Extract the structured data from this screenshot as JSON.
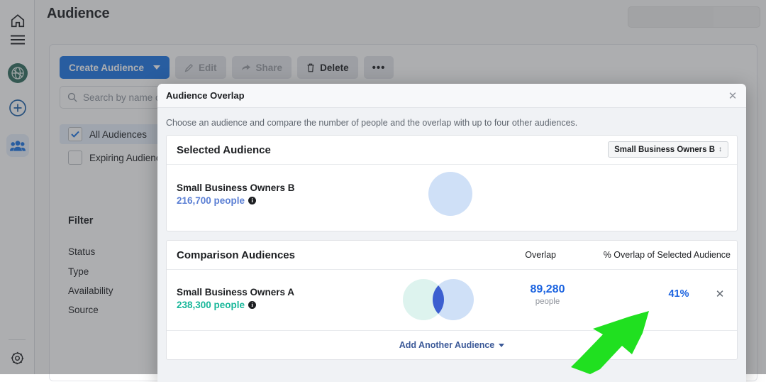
{
  "app": {
    "page_title": "Audience",
    "rail": [
      {
        "name": "home-icon",
        "label": "Home"
      },
      {
        "name": "menu-icon",
        "label": "Menu"
      },
      {
        "name": "globe-icon",
        "label": "Business"
      },
      {
        "name": "plus-circle-icon",
        "label": "Create"
      },
      {
        "name": "people-icon",
        "label": "Audiences"
      },
      {
        "name": "gear-icon",
        "label": "Settings"
      }
    ],
    "toolbar": {
      "create_label": "Create Audience",
      "edit_label": "Edit",
      "share_label": "Share",
      "delete_label": "Delete",
      "more_label": "•••"
    },
    "search": {
      "placeholder": "Search by name or audience ID"
    },
    "checks": [
      {
        "label": "All Audiences",
        "checked": true
      },
      {
        "label": "Expiring Audiences",
        "checked": false
      }
    ],
    "filter": {
      "heading": "Filter",
      "items": [
        "Status",
        "Type",
        "Availability",
        "Source"
      ]
    }
  },
  "modal": {
    "title": "Audience Overlap",
    "close_label": "✕",
    "subtitle": "Choose an audience and compare the number of people and the overlap with up to four other audiences.",
    "selected": {
      "heading": "Selected Audience",
      "selector_value": "Small Business Owners B",
      "audience_name": "Small Business Owners B",
      "audience_people": "216,700 people",
      "info_glyph": "i",
      "circle_color": "#cfe0f7"
    },
    "comparison": {
      "heading": "Comparison Audiences",
      "col_overlap": "Overlap",
      "col_pct": "% Overlap of Selected Audience",
      "rows": [
        {
          "audience_name": "Small Business Owners A",
          "audience_people": "238,300 people",
          "people_color": "#18b79a",
          "overlap_value": "89,280",
          "overlap_unit": "people",
          "pct": "41%",
          "remove_label": "✕"
        }
      ],
      "add_label": "Add Another Audience"
    }
  },
  "annotation": {
    "arrow_color": "#20e020",
    "points_to": "41%"
  },
  "colors": {
    "primary_blue": "#1b74e4",
    "link_blue": "#1b63e0",
    "teal": "#18b79a",
    "venn_left": "#ddf3ee",
    "venn_right": "#cfe0f7",
    "venn_overlap": "#3c5fd0"
  }
}
